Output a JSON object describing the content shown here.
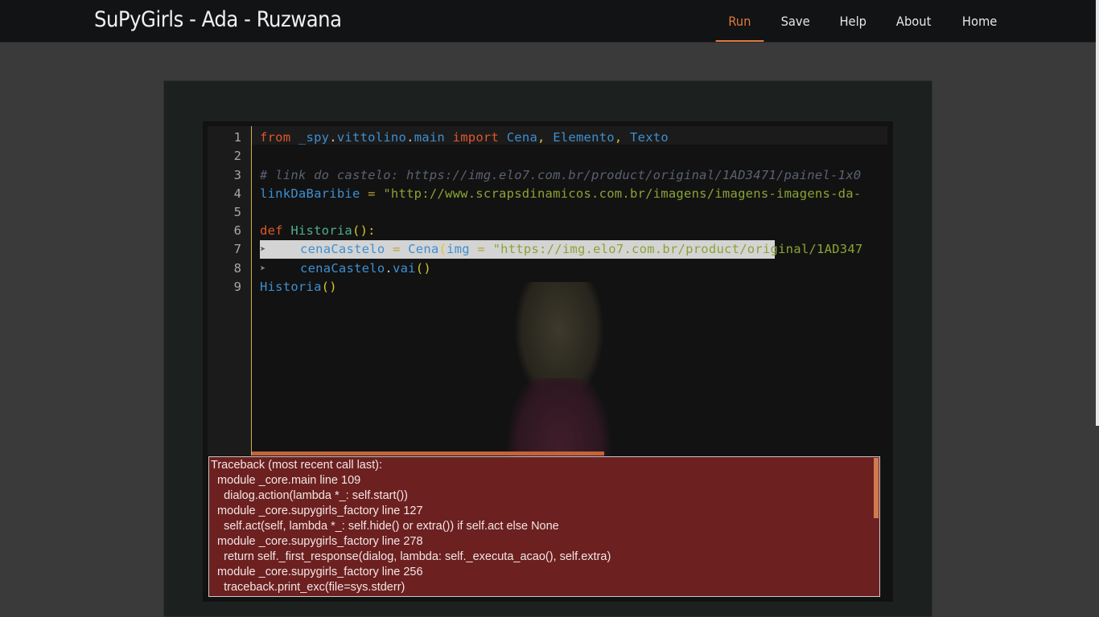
{
  "app": {
    "title": "SuPyGirls - Ada - Ruzwana"
  },
  "nav": {
    "items": [
      {
        "label": "Run",
        "active": true
      },
      {
        "label": "Save",
        "active": false
      },
      {
        "label": "Help",
        "active": false
      },
      {
        "label": "About",
        "active": false
      },
      {
        "label": "Home",
        "active": false
      }
    ]
  },
  "editor": {
    "line_numbers": [
      "1",
      "2",
      "3",
      "4",
      "5",
      "6",
      "7",
      "8",
      "9"
    ],
    "lines": {
      "l1": [
        "from",
        " ",
        "_spy",
        ".",
        "vittolino",
        ".",
        "main",
        " ",
        "import",
        " ",
        "Cena",
        ", ",
        "Elemento",
        ", ",
        "Texto"
      ],
      "l3": "# link do castelo: https://img.elo7.com.br/product/original/1AD3471/painel-1x0",
      "l4": [
        "linkDaBaribie",
        " = ",
        "\"http://www.scrapsdinamicos.com.br/imagens/imagens-imagens-da-"
      ],
      "l6": [
        "def",
        " ",
        "Historia",
        "():"
      ],
      "l7": [
        "cenaCastelo",
        " = ",
        "Cena",
        "(",
        "img",
        " = ",
        "\"https://img.elo7.com.br/product/original/1AD347"
      ],
      "l8": [
        "cenaCastelo",
        ".",
        "vai",
        "()"
      ],
      "l9": [
        "Historia",
        "()"
      ]
    },
    "fold_marker": "➤"
  },
  "console": {
    "lines": [
      "Traceback (most recent call last):",
      "  module _core.main line 109",
      "    dialog.action(lambda *_: self.start())",
      "  module _core.supygirls_factory line 127",
      "    self.act(self, lambda *_: self.hide() or extra()) if self.act else None",
      "  module _core.supygirls_factory line 278",
      "    return self._first_response(dialog, lambda: self._executa_acao(), self.extra)",
      "  module _core.supygirls_factory line 256",
      "    traceback.print_exc(file=sys.stderr)"
    ]
  },
  "colors": {
    "accent": "#e07a3c",
    "console_bg": "#6d2020",
    "editor_bg": "#121212"
  }
}
